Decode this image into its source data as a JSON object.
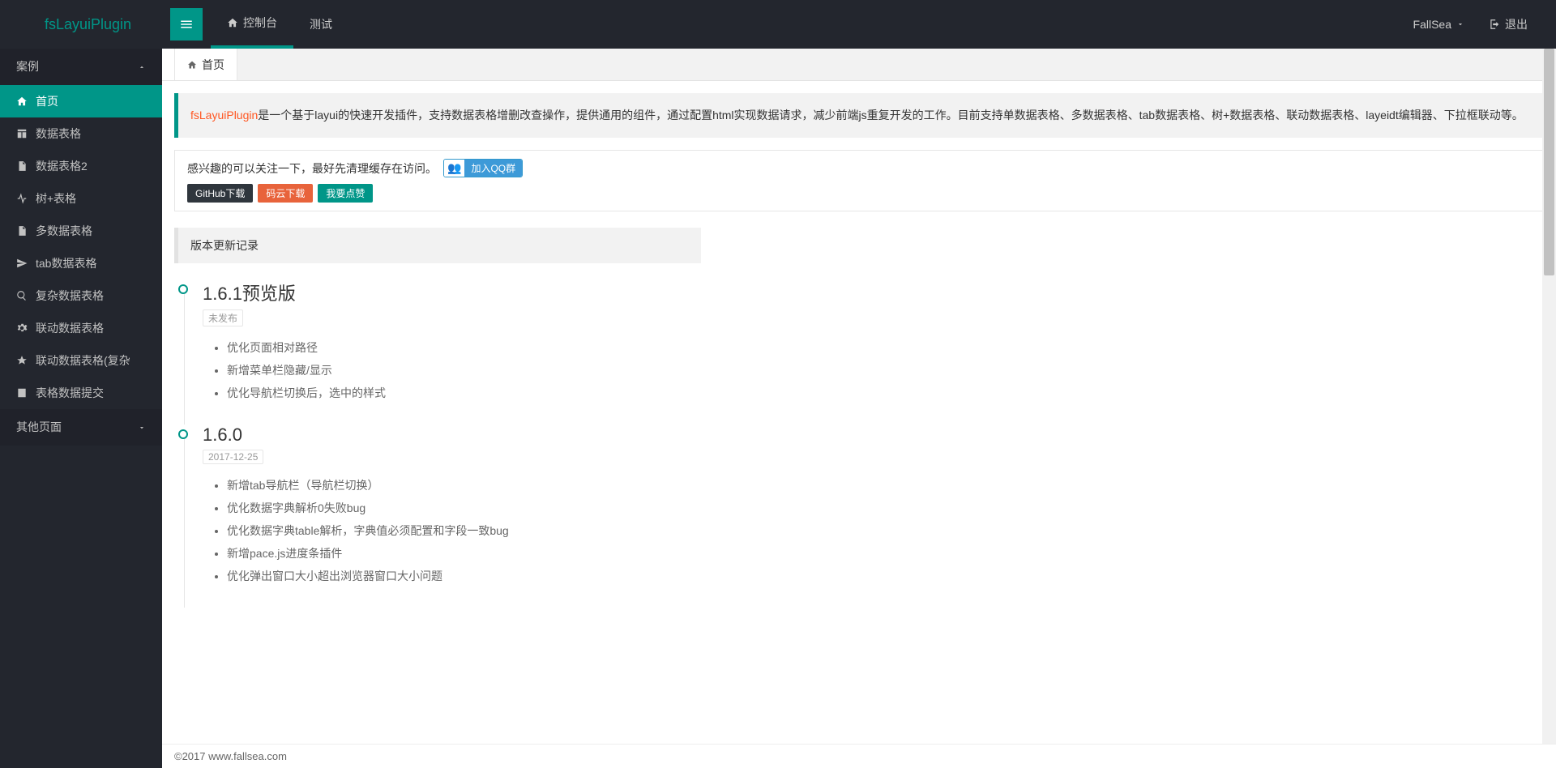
{
  "brand": "fsLayuiPlugin",
  "header": {
    "console": "控制台",
    "test": "测试",
    "username": "FallSea",
    "logout": "退出"
  },
  "sidebar": {
    "group1": {
      "title": "案例"
    },
    "items": [
      {
        "label": "首页",
        "icon": "home"
      },
      {
        "label": "数据表格",
        "icon": "table"
      },
      {
        "label": "数据表格2",
        "icon": "file"
      },
      {
        "label": "树+表格",
        "icon": "pulse"
      },
      {
        "label": "多数据表格",
        "icon": "file"
      },
      {
        "label": "tab数据表格",
        "icon": "send"
      },
      {
        "label": "复杂数据表格",
        "icon": "search"
      },
      {
        "label": "联动数据表格",
        "icon": "gear"
      },
      {
        "label": "联动数据表格(复杂",
        "icon": "star"
      },
      {
        "label": "表格数据提交",
        "icon": "form"
      }
    ],
    "group2": {
      "title": "其他页面"
    }
  },
  "tabs": {
    "home": "首页"
  },
  "intro": {
    "brand": "fsLayuiPlugin",
    "text": "是一个基于layui的快速开发插件，支持数据表格增删改查操作，提供通用的组件，通过配置html实现数据请求，减少前端js重复开发的工作。目前支持单数据表格、多数据表格、tab数据表格、树+数据表格、联动数据表格、layeidt编辑器、下拉框联动等。"
  },
  "attention": {
    "text": "感兴趣的可以关注一下，最好先清理缓存在访问。",
    "qq": "加入QQ群",
    "github": "GitHub下载",
    "gitee": "码云下载",
    "star": "我要点赞"
  },
  "changelog": {
    "title": "版本更新记录",
    "versions": [
      {
        "version": "1.6.1预览版",
        "date": "未发布",
        "changes": [
          "优化页面相对路径",
          "新增菜单栏隐藏/显示",
          "优化导航栏切换后，选中的样式"
        ]
      },
      {
        "version": "1.6.0",
        "date": "2017-12-25",
        "changes": [
          "新增tab导航栏（导航栏切换）",
          "优化数据字典解析0失败bug",
          "优化数据字典table解析，字典值必须配置和字段一致bug",
          "新增pace.js进度条插件",
          "优化弹出窗口大小超出浏览器窗口大小问题"
        ]
      }
    ]
  },
  "footer": "©2017 www.fallsea.com"
}
